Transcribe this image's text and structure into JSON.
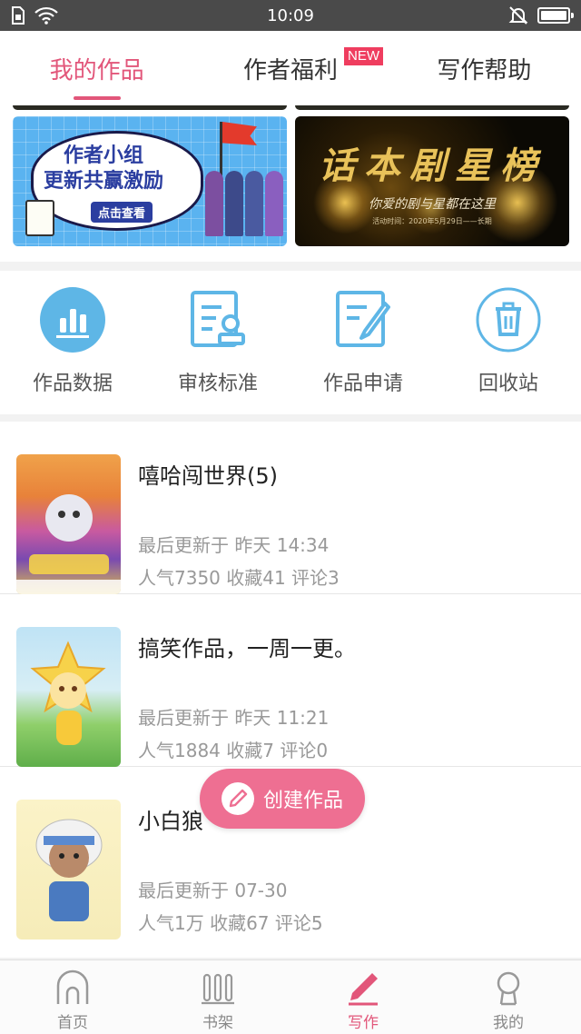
{
  "status_bar": {
    "time": "10:09"
  },
  "top_tabs": [
    {
      "label": "我的作品",
      "active": true
    },
    {
      "label": "作者福利",
      "badge": "NEW"
    },
    {
      "label": "写作帮助"
    }
  ],
  "banners": {
    "left": {
      "title_line1": "作者小组",
      "title_line2": "更新共赢激励",
      "button": "点击查看"
    },
    "right": {
      "title": "话本剧星榜",
      "subtitle": "你爱的剧与星都在这里",
      "time": "活动时间：2020年5月29日——长期"
    }
  },
  "quick_actions": [
    {
      "label": "作品数据",
      "icon": "bar-chart-icon"
    },
    {
      "label": "审核标准",
      "icon": "review-document-icon"
    },
    {
      "label": "作品申请",
      "icon": "edit-document-icon"
    },
    {
      "label": "回收站",
      "icon": "trash-icon"
    }
  ],
  "works": [
    {
      "title": "嘻哈闯世界(5)",
      "update": "最后更新于 昨天 14:34",
      "stats": "人气7350 收藏41 评论3"
    },
    {
      "title": "搞笑作品，一周一更。",
      "update": "最后更新于 昨天 11:21",
      "stats": "人气1884 收藏7 评论0"
    },
    {
      "title": "小白狼",
      "update": "最后更新于 07-30",
      "stats": "人气1万 收藏67 评论5"
    }
  ],
  "fab": {
    "label": "创建作品"
  },
  "bottom_nav": [
    {
      "label": "首页",
      "icon": "home-icon"
    },
    {
      "label": "书架",
      "icon": "bookshelf-icon"
    },
    {
      "label": "写作",
      "icon": "pen-icon",
      "active": true
    },
    {
      "label": "我的",
      "icon": "profile-icon"
    }
  ],
  "colors": {
    "accent": "#e2567a",
    "fab": "#ee6f92",
    "icon_blue": "#5eb6e6"
  }
}
